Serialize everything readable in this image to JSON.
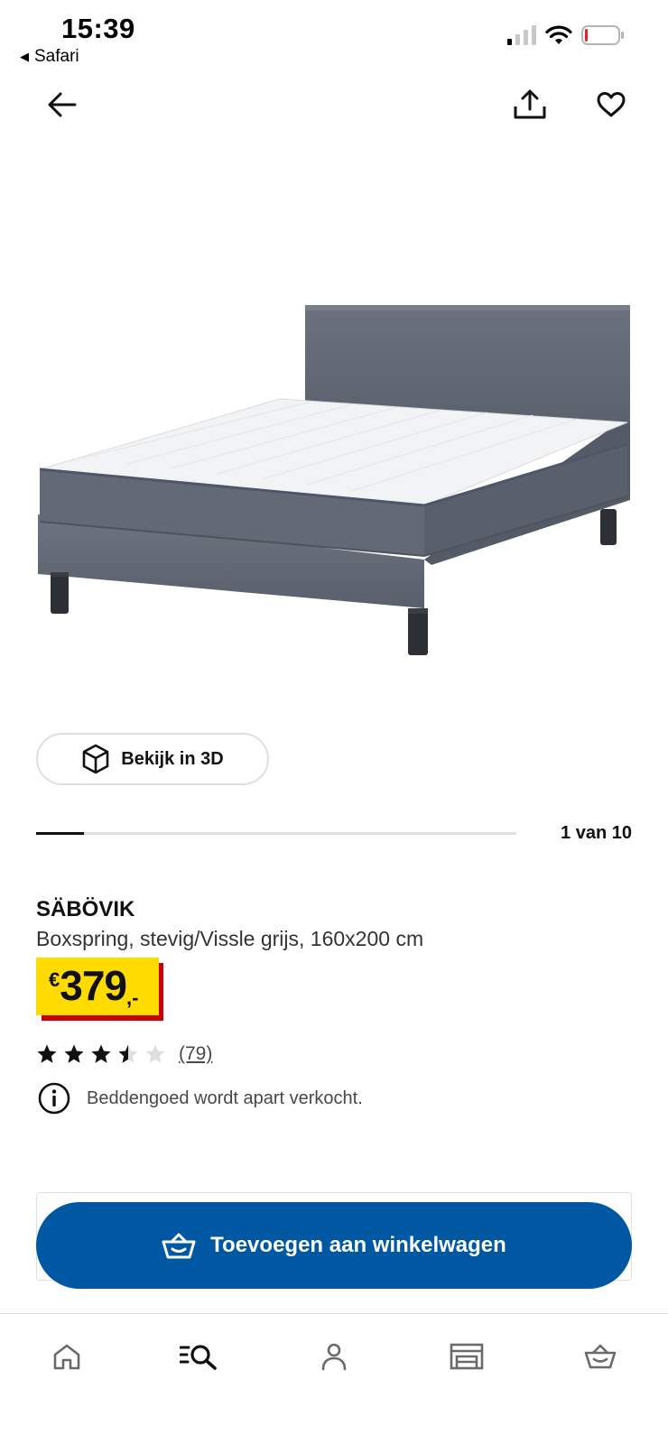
{
  "status_bar": {
    "time": "15:39",
    "back_app": "Safari"
  },
  "nav": {
    "back_icon": "arrow-left-icon",
    "share_icon": "share-icon",
    "favorite_icon": "heart-icon"
  },
  "product_image": {
    "icon": "boxspring-bed-image"
  },
  "view_3d": {
    "label": "Bekijk in 3D",
    "icon": "cube-3d-icon"
  },
  "carousel": {
    "counter": "1 van 10",
    "current": 1,
    "total": 10
  },
  "product": {
    "name": "SÄBÖVIK",
    "description": "Boxspring, stevig/Vissle grijs, 160x200 cm",
    "price": {
      "currency": "€",
      "integer": "379",
      "decimal": ",-"
    },
    "rating": {
      "value": 3.5,
      "max": 5,
      "count": "(79)"
    },
    "notice": "Beddengoed wordt apart verkocht."
  },
  "cart_button": {
    "label": "Toevoegen aan winkelwagen",
    "icon": "basket-icon"
  },
  "tab_bar": {
    "items": [
      {
        "icon": "home-icon"
      },
      {
        "icon": "search-list-icon"
      },
      {
        "icon": "profile-icon"
      },
      {
        "icon": "store-icon"
      },
      {
        "icon": "basket-icon"
      }
    ]
  },
  "colors": {
    "brand_blue": "#0058a3",
    "price_yellow": "#ffdb00",
    "price_red": "#cc0008",
    "text_dark": "#111111",
    "text_muted": "#484848"
  }
}
